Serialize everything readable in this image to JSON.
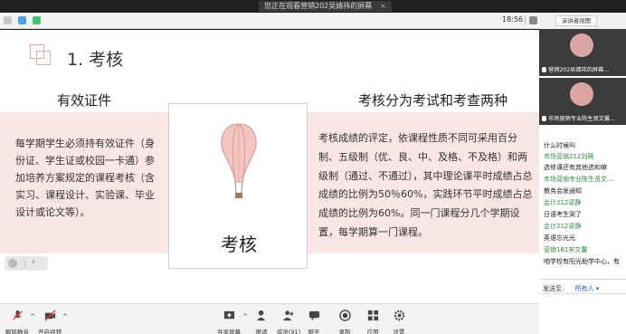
{
  "top_bar": {
    "share_title": "您正在观看营销202吴婧祎的屏幕",
    "close_glyph": "×"
  },
  "toolbar": {
    "time": "18:56"
  },
  "slide": {
    "title": "1. 考核",
    "left_heading": "有效证件",
    "left_text": "每学期学生必须持有效证件（身份证、学生证或校园一卡通）参加培养方案规定的课程考核（含实习、课程设计、实验课、毕业设计或论文等）。",
    "right_heading": "考核分为考试和考查两种",
    "right_text": "考核成绩的评定，依课程性质不同可采用百分制、五级制（优、良、中、及格、不及格）和两级制（通过、不通过），其中理论课平时成绩占总成绩的比例为50％60%，实践环节平时成绩占总成绩的比例为60%。同一门课程分几个学期设置，每学期算一门课程。",
    "card_label": "考核"
  },
  "bottom_bar": {
    "unmute": "解除静音",
    "start_video": "开启视频",
    "share_screen": "共享屏幕",
    "invite": "邀请",
    "participants": "成员(91)",
    "reactions": "聊天",
    "record": "录制",
    "apps": "应用",
    "settings": "设置"
  },
  "right_panel": {
    "view_button": "演讲者视图",
    "videos": [
      {
        "name": "营销202吴婧祎的屏幕..."
      },
      {
        "name": "市场营销专业陈生贤文馨..."
      }
    ],
    "chat": [
      {
        "kind": "msg",
        "text": "什么时候叫"
      },
      {
        "kind": "name",
        "text": "市场营销212刘萌"
      },
      {
        "kind": "msg",
        "text": "选修课还有其他选和嘛"
      },
      {
        "kind": "name",
        "text": "市场营销专业陈生贤文..."
      },
      {
        "kind": "msg",
        "text": "教务会发通知"
      },
      {
        "kind": "name",
        "text": "会计212梁静"
      },
      {
        "kind": "msg",
        "text": "日语考生哭了"
      },
      {
        "kind": "name",
        "text": "会计212梁静"
      },
      {
        "kind": "msg",
        "text": "英语忘光光"
      },
      {
        "kind": "name",
        "text": "营销181宋文馨"
      },
      {
        "kind": "msg",
        "text": "咱学校有阳光助学中心，有"
      }
    ],
    "send_to_label": "发送至:",
    "send_to_value": "所有人 ▾"
  },
  "colors": {
    "accent_pink": "#fae6e4",
    "chat_name": "#2f8c3c",
    "link_blue": "#1e5bd6"
  }
}
